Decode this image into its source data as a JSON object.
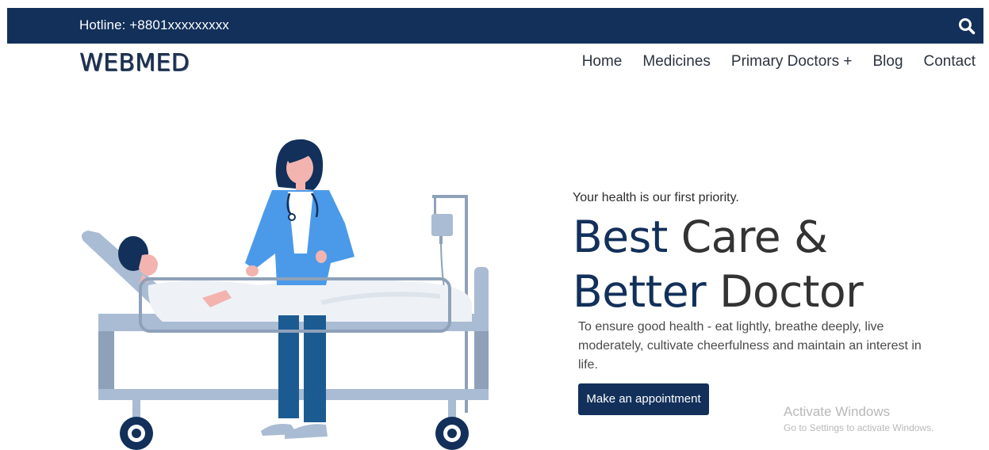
{
  "topbar": {
    "hotline": "Hotline: +8801xxxxxxxxx",
    "search_icon": "search-icon",
    "background": "#12305a"
  },
  "header": {
    "logo": "WEBMED",
    "nav": [
      {
        "label": "Home"
      },
      {
        "label": "Medicines"
      },
      {
        "label": "Primary Doctors +"
      },
      {
        "label": "Blog"
      },
      {
        "label": "Contact"
      }
    ]
  },
  "hero": {
    "tagline": "Your health is our first priority.",
    "headline_line1_accent": "Best",
    "headline_line1_rest": " Care &",
    "headline_line2_accent": "Better",
    "headline_line2_rest": " Doctor",
    "description": "To ensure good health - eat lightly, breathe deeply, live moderately, cultivate cheerfulness and maintain an interest in life.",
    "cta_label": "Make an appointment",
    "accent_color": "#12305a"
  },
  "watermark": {
    "title": "Activate Windows",
    "subtitle": "Go to Settings to activate Windows."
  }
}
